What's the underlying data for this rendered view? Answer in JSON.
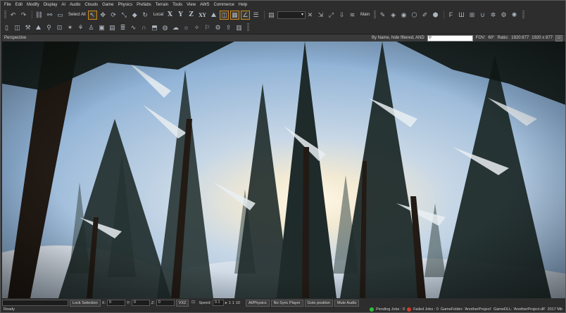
{
  "menu": [
    "File",
    "Edit",
    "Modify",
    "Display",
    "AI",
    "Audio",
    "Clouds",
    "Game",
    "Physics",
    "Prefabs",
    "Terrain",
    "Tools",
    "View",
    "AWS",
    "Commerce",
    "Help"
  ],
  "toolbar1": {
    "select_label": "Select All",
    "coord_system": "Local",
    "axes": [
      "X",
      "Y",
      "Z",
      "XY"
    ],
    "layer_label": "Main",
    "dropdown_value": ""
  },
  "viewport": {
    "title": "Perspective",
    "filter_text": "By Name, hide filtered, AND",
    "search_placeholder": "",
    "fov_label": "FOV:",
    "fov_value": "60°",
    "ratio_label": "Ratio:",
    "ratio_value": "1920:877",
    "resolution": "1920 x 877"
  },
  "statusrow": {
    "lock_selection": "Lock Selection",
    "x_label": "X:",
    "x_value": "0",
    "y_label": "Y:",
    "y_value": "0",
    "z_label": "Z:",
    "z_value": "0",
    "vxz": "VXZ",
    "speed_label": "Speed:",
    "speed_value": "0.1",
    "speed_opts": [
      "1",
      "1",
      "10"
    ],
    "ai_physics": "AI/Physics",
    "no_sync_player": "No Sync Player",
    "goto_position": "Goto position",
    "mute_audio": "Mute Audio"
  },
  "statusbar": {
    "ready": "Ready",
    "pending_jobs": "Pending Jobs : 0",
    "failed_jobs": "Failed Jobs : 0",
    "game_folder": "GameFolder: 'AnotherProject'",
    "game_dll": "GameDLL: 'AnotherProject.dll'",
    "memory": "2017 Mb",
    "colors": {
      "ok": "#2fc13a",
      "error": "#d23b2b"
    }
  }
}
